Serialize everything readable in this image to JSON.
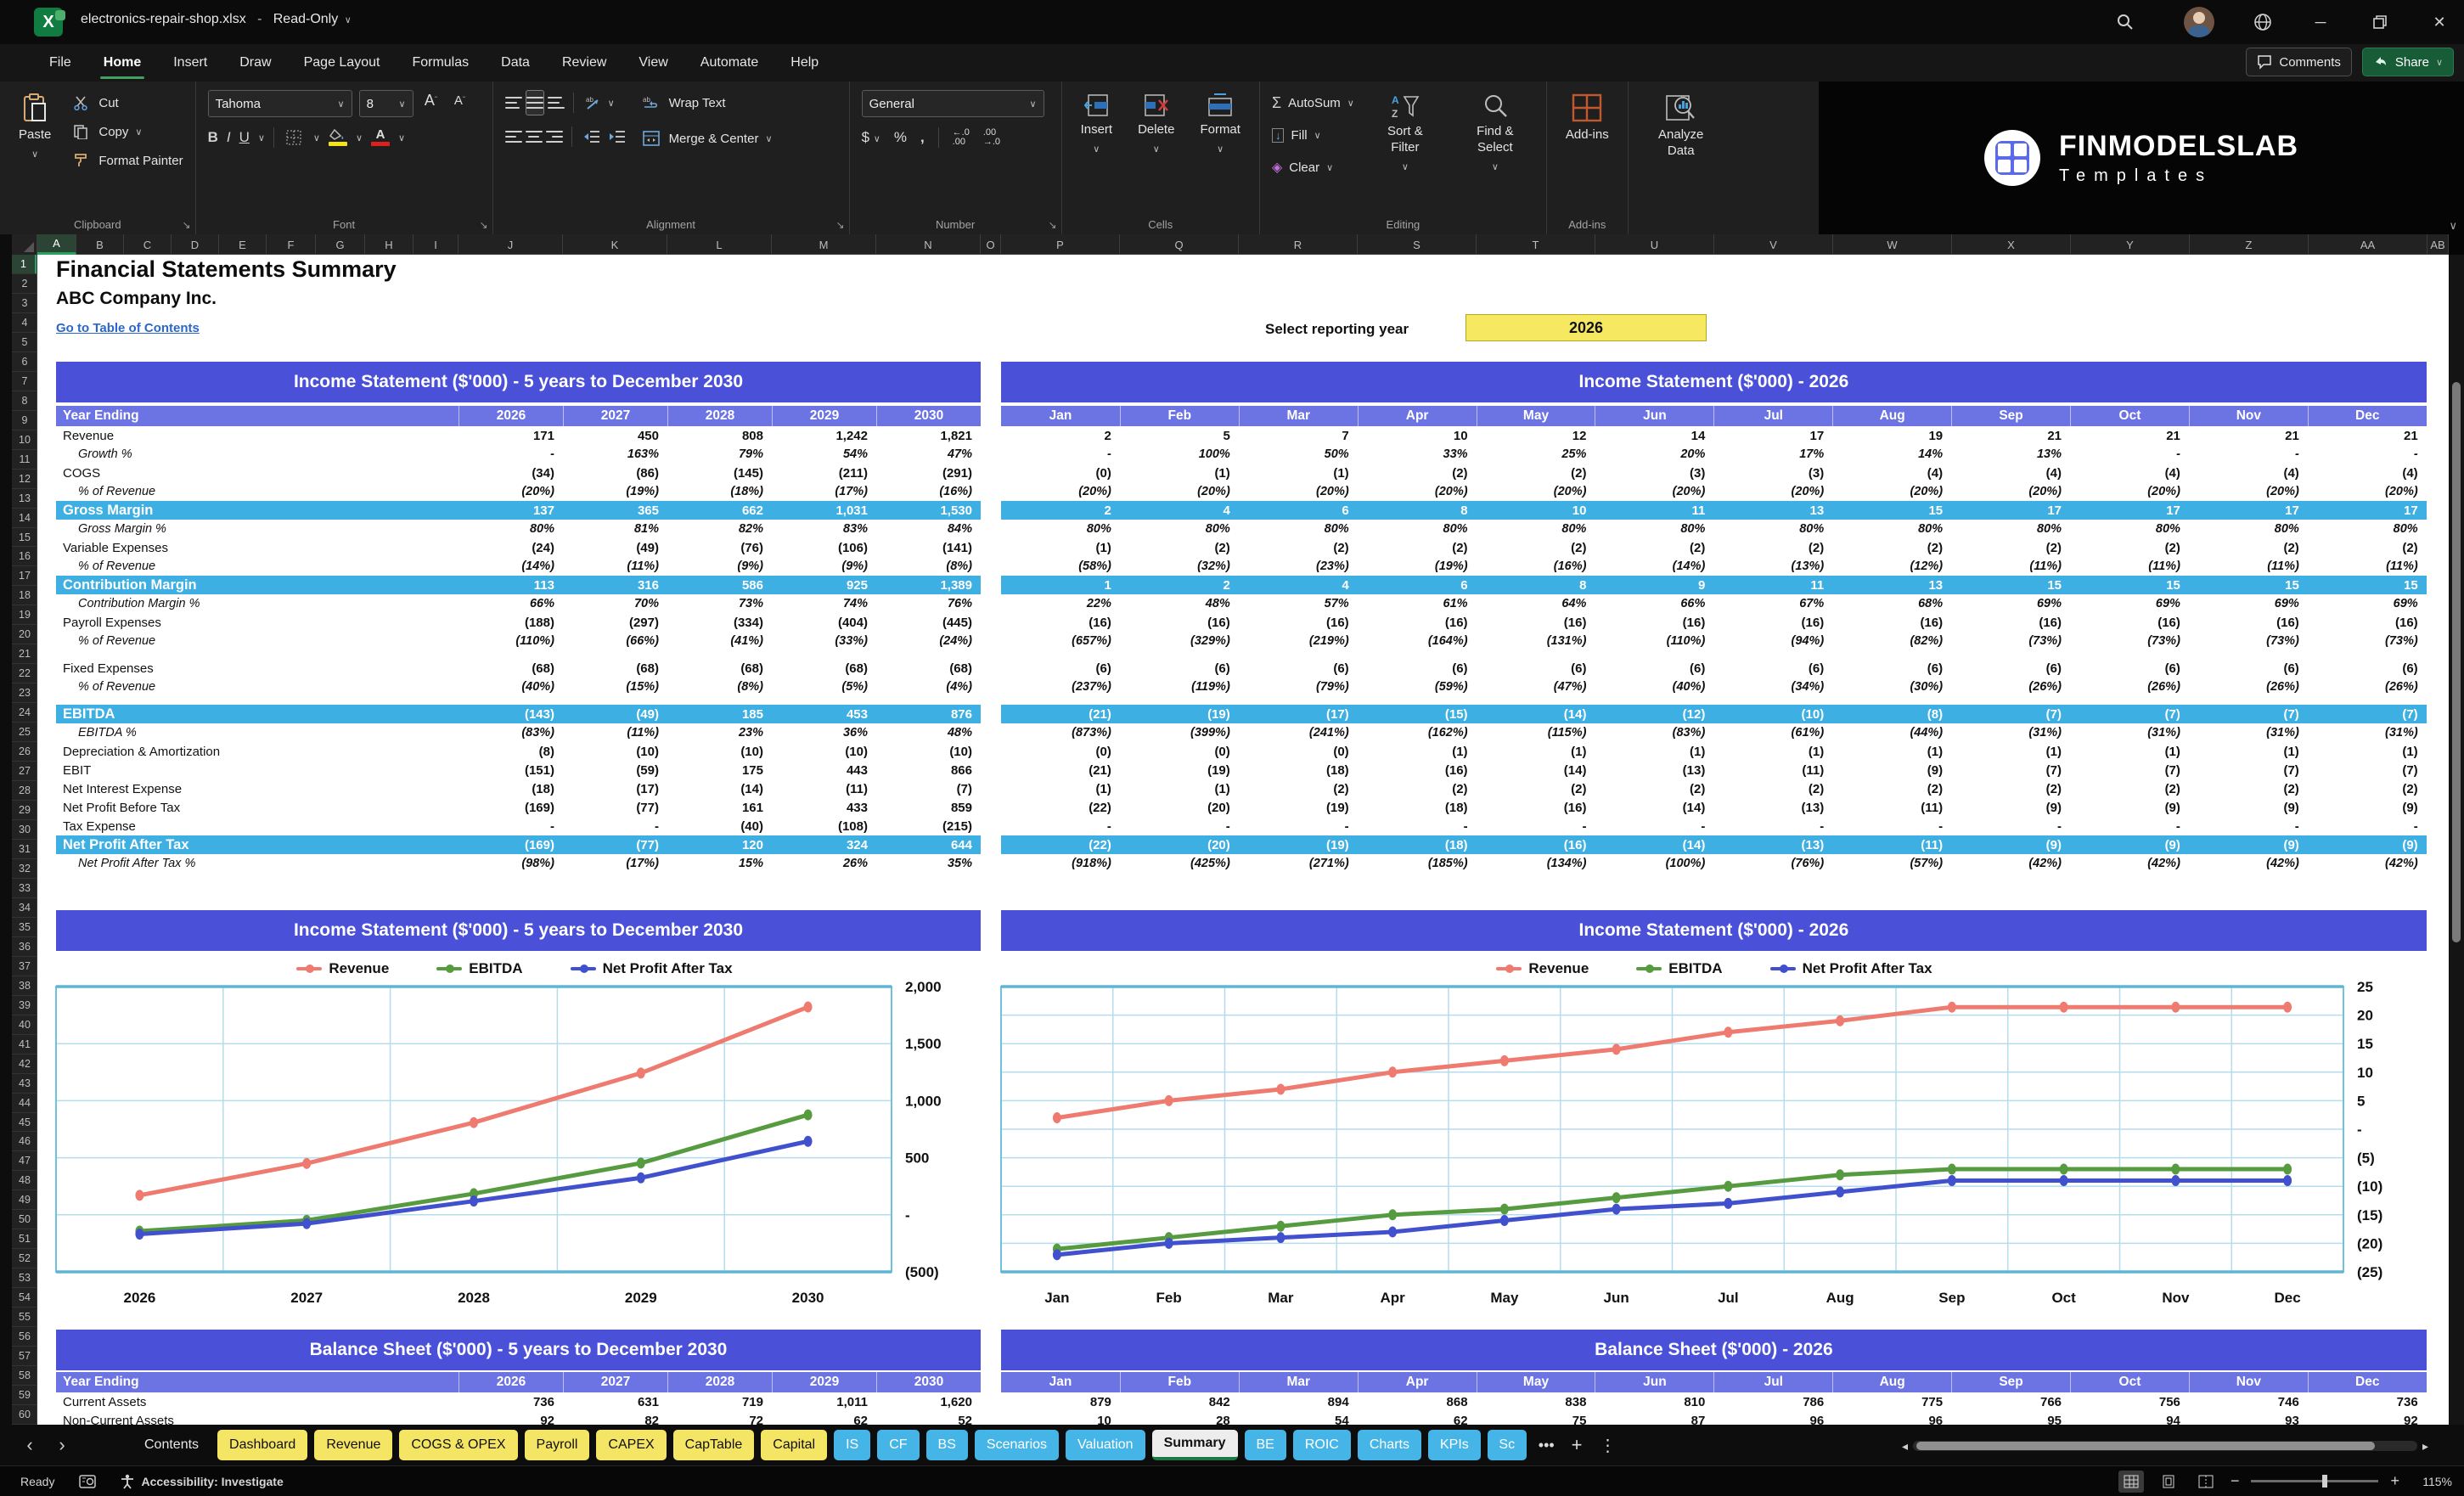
{
  "titlebar": {
    "filename": "electronics-repair-shop.xlsx",
    "separator": "-",
    "mode": "Read-Only"
  },
  "menu": {
    "items": [
      "File",
      "Home",
      "Insert",
      "Draw",
      "Page Layout",
      "Formulas",
      "Data",
      "Review",
      "View",
      "Automate",
      "Help"
    ],
    "active": "Home",
    "comments": "Comments",
    "share": "Share"
  },
  "ribbon": {
    "clipboard": {
      "paste": "Paste",
      "cut": "Cut",
      "copy": "Copy",
      "format_painter": "Format Painter",
      "label": "Clipboard"
    },
    "font": {
      "name": "Tahoma",
      "size": "8",
      "label": "Font"
    },
    "alignment": {
      "wrap": "Wrap Text",
      "merge": "Merge & Center",
      "label": "Alignment"
    },
    "number": {
      "format": "General",
      "label": "Number"
    },
    "cells": {
      "insert": "Insert",
      "delete": "Delete",
      "format": "Format",
      "label": "Cells"
    },
    "editing": {
      "autosum": "AutoSum",
      "fill": "Fill",
      "clear": "Clear",
      "sort": "Sort & Filter",
      "find": "Find & Select",
      "label": "Editing"
    },
    "addins": {
      "addins": "Add-ins",
      "analyze": "Analyze Data",
      "label": "Add-ins"
    }
  },
  "logo": {
    "brand": "FINMODELSLAB",
    "sub": "Templates"
  },
  "sheet": {
    "title": "Financial Statements Summary",
    "company": "ABC Company Inc.",
    "link": "Go to Table of Contents",
    "year_selector": {
      "label": "Select reporting year",
      "value": "2026"
    },
    "columns": [
      "A",
      "B",
      "C",
      "D",
      "E",
      "F",
      "G",
      "H",
      "I",
      "J",
      "K",
      "L",
      "M",
      "N",
      "O",
      "P",
      "Q",
      "R",
      "S",
      "T",
      "U",
      "V",
      "W",
      "X",
      "Y",
      "Z",
      "AA",
      "AB"
    ],
    "rows_visible": 60
  },
  "tables": {
    "year_ending_label": "Year Ending",
    "annual_columns": [
      "2026",
      "2027",
      "2028",
      "2029",
      "2030"
    ],
    "monthly_columns": [
      "Jan",
      "Feb",
      "Mar",
      "Apr",
      "May",
      "Jun",
      "Jul",
      "Aug",
      "Sep",
      "Oct",
      "Nov",
      "Dec"
    ],
    "is_banner_left": "Income Statement ($'000) - 5 years to December 2030",
    "is_banner_right": "Income Statement ($'000) - 2026",
    "bs_banner_left": "Balance Sheet ($'000) - 5 years to December 2030",
    "bs_banner_right": "Balance Sheet ($'000) - 2026",
    "is_rows": [
      {
        "label": "Revenue",
        "style": "num",
        "annual": [
          "171",
          "450",
          "808",
          "1,242",
          "1,821"
        ],
        "monthly": [
          "2",
          "5",
          "7",
          "10",
          "12",
          "14",
          "17",
          "19",
          "21",
          "21",
          "21",
          "21"
        ]
      },
      {
        "label": "Growth %",
        "style": "pct",
        "annual": [
          "-",
          "163%",
          "79%",
          "54%",
          "47%"
        ],
        "monthly": [
          "-",
          "100%",
          "50%",
          "33%",
          "25%",
          "20%",
          "17%",
          "14%",
          "13%",
          "-",
          "-",
          "-"
        ]
      },
      {
        "label": "COGS",
        "style": "num",
        "annual": [
          "(34)",
          "(86)",
          "(145)",
          "(211)",
          "(291)"
        ],
        "monthly": [
          "(0)",
          "(1)",
          "(1)",
          "(2)",
          "(2)",
          "(3)",
          "(3)",
          "(4)",
          "(4)",
          "(4)",
          "(4)",
          "(4)"
        ]
      },
      {
        "label": "% of Revenue",
        "style": "pct",
        "annual": [
          "(20%)",
          "(19%)",
          "(18%)",
          "(17%)",
          "(16%)"
        ],
        "monthly": [
          "(20%)",
          "(20%)",
          "(20%)",
          "(20%)",
          "(20%)",
          "(20%)",
          "(20%)",
          "(20%)",
          "(20%)",
          "(20%)",
          "(20%)",
          "(20%)"
        ]
      },
      {
        "label": "Gross Margin",
        "style": "hl",
        "annual": [
          "137",
          "365",
          "662",
          "1,031",
          "1,530"
        ],
        "monthly": [
          "2",
          "4",
          "6",
          "8",
          "10",
          "11",
          "13",
          "15",
          "17",
          "17",
          "17",
          "17"
        ]
      },
      {
        "label": "Gross Margin %",
        "style": "pct",
        "annual": [
          "80%",
          "81%",
          "82%",
          "83%",
          "84%"
        ],
        "monthly": [
          "80%",
          "80%",
          "80%",
          "80%",
          "80%",
          "80%",
          "80%",
          "80%",
          "80%",
          "80%",
          "80%",
          "80%"
        ]
      },
      {
        "label": "Variable Expenses",
        "style": "num",
        "annual": [
          "(24)",
          "(49)",
          "(76)",
          "(106)",
          "(141)"
        ],
        "monthly": [
          "(1)",
          "(2)",
          "(2)",
          "(2)",
          "(2)",
          "(2)",
          "(2)",
          "(2)",
          "(2)",
          "(2)",
          "(2)",
          "(2)"
        ]
      },
      {
        "label": "% of Revenue",
        "style": "pct",
        "annual": [
          "(14%)",
          "(11%)",
          "(9%)",
          "(9%)",
          "(8%)"
        ],
        "monthly": [
          "(58%)",
          "(32%)",
          "(23%)",
          "(19%)",
          "(16%)",
          "(14%)",
          "(13%)",
          "(12%)",
          "(11%)",
          "(11%)",
          "(11%)",
          "(11%)"
        ]
      },
      {
        "label": "Contribution Margin",
        "style": "hl",
        "annual": [
          "113",
          "316",
          "586",
          "925",
          "1,389"
        ],
        "monthly": [
          "1",
          "2",
          "4",
          "6",
          "8",
          "9",
          "11",
          "13",
          "15",
          "15",
          "15",
          "15"
        ]
      },
      {
        "label": "Contribution Margin %",
        "style": "pct",
        "annual": [
          "66%",
          "70%",
          "73%",
          "74%",
          "76%"
        ],
        "monthly": [
          "22%",
          "48%",
          "57%",
          "61%",
          "64%",
          "66%",
          "67%",
          "68%",
          "69%",
          "69%",
          "69%",
          "69%"
        ]
      },
      {
        "label": "Payroll Expenses",
        "style": "num",
        "annual": [
          "(188)",
          "(297)",
          "(334)",
          "(404)",
          "(445)"
        ],
        "monthly": [
          "(16)",
          "(16)",
          "(16)",
          "(16)",
          "(16)",
          "(16)",
          "(16)",
          "(16)",
          "(16)",
          "(16)",
          "(16)",
          "(16)"
        ]
      },
      {
        "label": "% of Revenue",
        "style": "pct",
        "annual": [
          "(110%)",
          "(66%)",
          "(41%)",
          "(33%)",
          "(24%)"
        ],
        "monthly": [
          "(657%)",
          "(329%)",
          "(219%)",
          "(164%)",
          "(131%)",
          "(110%)",
          "(94%)",
          "(82%)",
          "(73%)",
          "(73%)",
          "(73%)",
          "(73%)"
        ]
      },
      {
        "label": "",
        "style": "spacer",
        "annual": [],
        "monthly": []
      },
      {
        "label": "Fixed Expenses",
        "style": "num",
        "annual": [
          "(68)",
          "(68)",
          "(68)",
          "(68)",
          "(68)"
        ],
        "monthly": [
          "(6)",
          "(6)",
          "(6)",
          "(6)",
          "(6)",
          "(6)",
          "(6)",
          "(6)",
          "(6)",
          "(6)",
          "(6)",
          "(6)"
        ]
      },
      {
        "label": "% of Revenue",
        "style": "pct",
        "annual": [
          "(40%)",
          "(15%)",
          "(8%)",
          "(5%)",
          "(4%)"
        ],
        "monthly": [
          "(237%)",
          "(119%)",
          "(79%)",
          "(59%)",
          "(47%)",
          "(40%)",
          "(34%)",
          "(30%)",
          "(26%)",
          "(26%)",
          "(26%)",
          "(26%)"
        ]
      },
      {
        "label": "",
        "style": "spacer",
        "annual": [],
        "monthly": []
      },
      {
        "label": "EBITDA",
        "style": "hl",
        "annual": [
          "(143)",
          "(49)",
          "185",
          "453",
          "876"
        ],
        "monthly": [
          "(21)",
          "(19)",
          "(17)",
          "(15)",
          "(14)",
          "(12)",
          "(10)",
          "(8)",
          "(7)",
          "(7)",
          "(7)",
          "(7)"
        ]
      },
      {
        "label": "EBITDA %",
        "style": "pct",
        "annual": [
          "(83%)",
          "(11%)",
          "23%",
          "36%",
          "48%"
        ],
        "monthly": [
          "(873%)",
          "(399%)",
          "(241%)",
          "(162%)",
          "(115%)",
          "(83%)",
          "(61%)",
          "(44%)",
          "(31%)",
          "(31%)",
          "(31%)",
          "(31%)"
        ]
      },
      {
        "label": "Depreciation & Amortization",
        "style": "num",
        "annual": [
          "(8)",
          "(10)",
          "(10)",
          "(10)",
          "(10)"
        ],
        "monthly": [
          "(0)",
          "(0)",
          "(0)",
          "(1)",
          "(1)",
          "(1)",
          "(1)",
          "(1)",
          "(1)",
          "(1)",
          "(1)",
          "(1)"
        ]
      },
      {
        "label": "EBIT",
        "style": "num",
        "annual": [
          "(151)",
          "(59)",
          "175",
          "443",
          "866"
        ],
        "monthly": [
          "(21)",
          "(19)",
          "(18)",
          "(16)",
          "(14)",
          "(13)",
          "(11)",
          "(9)",
          "(7)",
          "(7)",
          "(7)",
          "(7)"
        ]
      },
      {
        "label": "Net Interest Expense",
        "style": "num",
        "annual": [
          "(18)",
          "(17)",
          "(14)",
          "(11)",
          "(7)"
        ],
        "monthly": [
          "(1)",
          "(1)",
          "(2)",
          "(2)",
          "(2)",
          "(2)",
          "(2)",
          "(2)",
          "(2)",
          "(2)",
          "(2)",
          "(2)"
        ]
      },
      {
        "label": "Net Profit Before Tax",
        "style": "num",
        "annual": [
          "(169)",
          "(77)",
          "161",
          "433",
          "859"
        ],
        "monthly": [
          "(22)",
          "(20)",
          "(19)",
          "(18)",
          "(16)",
          "(14)",
          "(13)",
          "(11)",
          "(9)",
          "(9)",
          "(9)",
          "(9)"
        ]
      },
      {
        "label": "Tax Expense",
        "style": "num",
        "annual": [
          "-",
          "-",
          "(40)",
          "(108)",
          "(215)"
        ],
        "monthly": [
          "-",
          "-",
          "-",
          "-",
          "-",
          "-",
          "-",
          "-",
          "-",
          "-",
          "-",
          "-"
        ]
      },
      {
        "label": "Net Profit After Tax",
        "style": "hl",
        "annual": [
          "(169)",
          "(77)",
          "120",
          "324",
          "644"
        ],
        "monthly": [
          "(22)",
          "(20)",
          "(19)",
          "(18)",
          "(16)",
          "(14)",
          "(13)",
          "(11)",
          "(9)",
          "(9)",
          "(9)",
          "(9)"
        ]
      },
      {
        "label": "Net Profit After Tax %",
        "style": "pct",
        "annual": [
          "(98%)",
          "(17%)",
          "15%",
          "26%",
          "35%"
        ],
        "monthly": [
          "(918%)",
          "(425%)",
          "(271%)",
          "(185%)",
          "(134%)",
          "(100%)",
          "(76%)",
          "(57%)",
          "(42%)",
          "(42%)",
          "(42%)",
          "(42%)"
        ]
      }
    ],
    "bs_rows": [
      {
        "label": "Current Assets",
        "style": "num",
        "annual": [
          "736",
          "631",
          "719",
          "1,011",
          "1,620"
        ],
        "monthly": [
          "879",
          "842",
          "894",
          "868",
          "838",
          "810",
          "786",
          "775",
          "766",
          "756",
          "746",
          "736"
        ]
      },
      {
        "label": "Non-Current Assets",
        "style": "num",
        "annual": [
          "92",
          "82",
          "72",
          "62",
          "52"
        ],
        "monthly": [
          "10",
          "28",
          "54",
          "62",
          "75",
          "87",
          "96",
          "96",
          "95",
          "94",
          "93",
          "92"
        ]
      }
    ]
  },
  "chart_data": [
    {
      "type": "line",
      "title": "Income Statement ($'000) - 5 years to December 2030",
      "categories": [
        "2026",
        "2027",
        "2028",
        "2029",
        "2030"
      ],
      "series": [
        {
          "name": "Revenue",
          "color": "#ee7a70",
          "values": [
            171,
            450,
            808,
            1242,
            1821
          ]
        },
        {
          "name": "EBITDA",
          "color": "#579b40",
          "values": [
            -143,
            -49,
            185,
            453,
            876
          ]
        },
        {
          "name": "Net Profit After Tax",
          "color": "#4150cc",
          "values": [
            -169,
            -77,
            120,
            324,
            644
          ]
        }
      ],
      "ylim": [
        -500,
        2000
      ],
      "ytick_values": [
        2000,
        1500,
        1000,
        500,
        0,
        -500
      ],
      "ytick_labels": [
        "2,000",
        "1,500",
        "1,000",
        "500",
        "-",
        "(500)"
      ],
      "legend_position": "top",
      "grid": true
    },
    {
      "type": "line",
      "title": "Income Statement ($'000) - 2026",
      "categories": [
        "Jan",
        "Feb",
        "Mar",
        "Apr",
        "May",
        "Jun",
        "Jul",
        "Aug",
        "Sep",
        "Oct",
        "Nov",
        "Dec"
      ],
      "series": [
        {
          "name": "Revenue",
          "color": "#ee7a70",
          "values": [
            2,
            5,
            7,
            10,
            12,
            14,
            17,
            19,
            21.4,
            21.4,
            21.4,
            21.4
          ]
        },
        {
          "name": "EBITDA",
          "color": "#579b40",
          "values": [
            -21,
            -19,
            -17,
            -15,
            -14,
            -12,
            -10,
            -8,
            -7,
            -7,
            -7,
            -7
          ]
        },
        {
          "name": "Net Profit After Tax",
          "color": "#4150cc",
          "values": [
            -22,
            -20,
            -19,
            -18,
            -16,
            -14,
            -13,
            -11,
            -9,
            -9,
            -9,
            -9
          ]
        }
      ],
      "ylim": [
        -25,
        25
      ],
      "ytick_values": [
        25,
        20,
        15,
        10,
        5,
        0,
        -5,
        -10,
        -15,
        -20,
        -25
      ],
      "ytick_labels": [
        "25",
        "20",
        "15",
        "10",
        "5",
        "-",
        "(5)",
        "(10)",
        "(15)",
        "(20)",
        "(25)"
      ],
      "legend_position": "top",
      "grid": true
    }
  ],
  "tabs": {
    "items": [
      {
        "label": "Contents",
        "type": "plain"
      },
      {
        "label": "Dashboard",
        "type": "yellow"
      },
      {
        "label": "Revenue",
        "type": "yellow"
      },
      {
        "label": "COGS & OPEX",
        "type": "yellow"
      },
      {
        "label": "Payroll",
        "type": "yellow"
      },
      {
        "label": "CAPEX",
        "type": "yellow"
      },
      {
        "label": "CapTable",
        "type": "yellow"
      },
      {
        "label": "Capital",
        "type": "yellow"
      },
      {
        "label": "IS",
        "type": "blue"
      },
      {
        "label": "CF",
        "type": "blue"
      },
      {
        "label": "BS",
        "type": "blue"
      },
      {
        "label": "Scenarios",
        "type": "blue"
      },
      {
        "label": "Valuation",
        "type": "blue"
      },
      {
        "label": "Summary",
        "type": "active"
      },
      {
        "label": "BE",
        "type": "blue"
      },
      {
        "label": "ROIC",
        "type": "blue"
      },
      {
        "label": "Charts",
        "type": "blue"
      },
      {
        "label": "KPIs",
        "type": "blue"
      },
      {
        "label": "Sc",
        "type": "blue",
        "truncated": true
      }
    ],
    "more": "•••",
    "add": "+",
    "menu": "⋮"
  },
  "statusbar": {
    "ready": "Ready",
    "accessibility": "Accessibility: Investigate",
    "zoom": "115%"
  }
}
